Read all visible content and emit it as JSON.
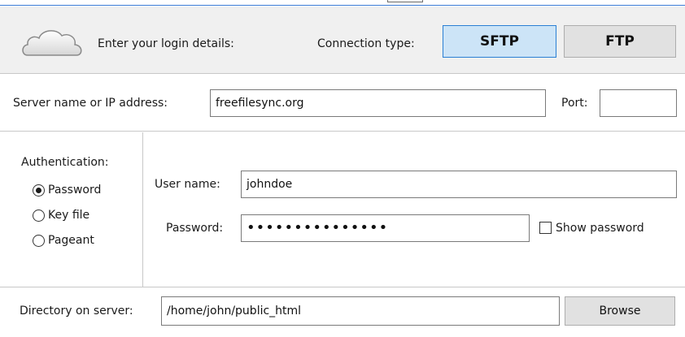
{
  "header": {
    "login_label": "Enter your login details:",
    "connection_type_label": "Connection type:",
    "types": {
      "sftp": "SFTP",
      "ftp": "FTP"
    },
    "selected_type": "SFTP"
  },
  "server": {
    "label": "Server name or IP address:",
    "value": "freefilesync.org",
    "port_label": "Port:",
    "port_value": ""
  },
  "auth": {
    "label": "Authentication:",
    "options": [
      {
        "label": "Password",
        "checked": true
      },
      {
        "label": "Key file",
        "checked": false
      },
      {
        "label": "Pageant",
        "checked": false
      }
    ],
    "username_label": "User name:",
    "username_value": "johndoe",
    "password_label": "Password:",
    "password_value": "•••••••••••••••",
    "show_password_label": "Show password",
    "show_password_checked": false
  },
  "directory": {
    "label": "Directory on server:",
    "value": "/home/john/public_html",
    "browse_label": "Browse"
  },
  "colors": {
    "accent": "#3a7bd5",
    "selected_button_bg": "#cce4f7",
    "header_bg": "#f0f0f0"
  }
}
